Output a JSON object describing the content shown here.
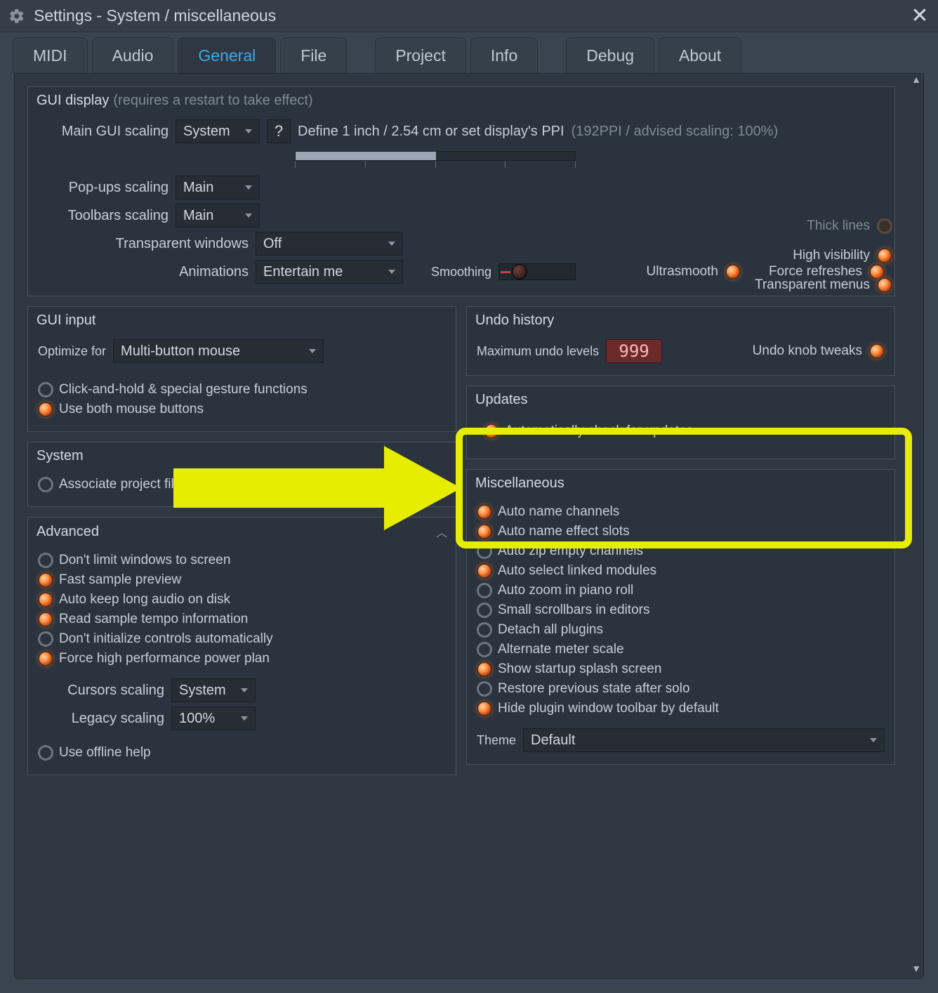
{
  "title": "Settings - System / miscellaneous",
  "tabs": [
    "MIDI",
    "Audio",
    "General",
    "File",
    "Project",
    "Info",
    "Debug",
    "About"
  ],
  "active_tab": "General",
  "gui_display": {
    "header": "GUI display",
    "hint": "(requires a restart to take effect)",
    "main_scaling_label": "Main GUI scaling",
    "main_scaling_value": "System",
    "ppi_label": "Define 1 inch / 2.54 cm or set display's PPI",
    "ppi_hint": "(192PPI / advised scaling: 100%)",
    "popups_label": "Pop-ups scaling",
    "popups_value": "Main",
    "toolbars_label": "Toolbars scaling",
    "toolbars_value": "Main",
    "transparent_label": "Transparent windows",
    "transparent_value": "Off",
    "animations_label": "Animations",
    "animations_value": "Entertain me",
    "smoothing_label": "Smoothing",
    "ultrasmooth_label": "Ultrasmooth",
    "force_refresh_label": "Force refreshes",
    "thick_lines_label": "Thick lines",
    "high_vis_label": "High visibility",
    "transparent_menus_label": "Transparent menus"
  },
  "gui_input": {
    "header": "GUI input",
    "optimize_label": "Optimize for",
    "optimize_value": "Multi-button mouse",
    "click_hold_label": "Click-and-hold & special gesture functions",
    "use_both_label": "Use both mouse buttons"
  },
  "undo": {
    "header": "Undo history",
    "max_label": "Maximum undo levels",
    "max_value": "999",
    "knob_label": "Undo knob tweaks"
  },
  "updates": {
    "header": "Updates",
    "auto_check_label": "Automatically check for updates"
  },
  "system": {
    "header": "System",
    "associate_label": "Associate project files with application"
  },
  "advanced": {
    "header": "Advanced",
    "items": [
      {
        "label": "Don't limit windows to screen",
        "on": false
      },
      {
        "label": "Fast sample preview",
        "on": true
      },
      {
        "label": "Auto keep long audio on disk",
        "on": true
      },
      {
        "label": "Read sample tempo information",
        "on": true
      },
      {
        "label": "Don't initialize controls automatically",
        "on": false
      },
      {
        "label": "Force high performance power plan",
        "on": true
      }
    ],
    "cursors_label": "Cursors scaling",
    "cursors_value": "System",
    "legacy_label": "Legacy scaling",
    "legacy_value": "100%",
    "offline_label": "Use offline help"
  },
  "misc": {
    "header": "Miscellaneous",
    "items": [
      {
        "label": "Auto name channels",
        "on": true
      },
      {
        "label": "Auto name effect slots",
        "on": true
      },
      {
        "label": "Auto zip empty channels",
        "on": false
      },
      {
        "label": "Auto select linked modules",
        "on": true
      },
      {
        "label": "Auto zoom in piano roll",
        "on": false
      },
      {
        "label": "Small scrollbars in editors",
        "on": false
      },
      {
        "label": "Detach all plugins",
        "on": false
      },
      {
        "label": "Alternate meter scale",
        "on": false
      },
      {
        "label": "Show startup splash screen",
        "on": true
      },
      {
        "label": "Restore previous state after solo",
        "on": false
      },
      {
        "label": "Hide plugin window toolbar by default",
        "on": true
      }
    ],
    "theme_label": "Theme",
    "theme_value": "Default"
  }
}
